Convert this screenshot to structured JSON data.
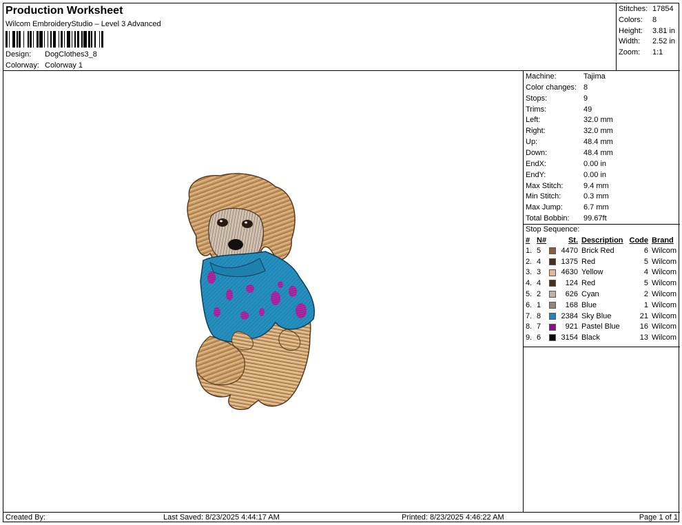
{
  "header": {
    "title": "Production Worksheet",
    "subtitle": "Wilcom EmbroideryStudio – Level 3 Advanced",
    "design_label": "Design:",
    "design_value": "DogClothes3_8",
    "colorway_label": "Colorway:",
    "colorway_value": "Colorway 1"
  },
  "stats": [
    {
      "k": "Stitches:",
      "v": "17854"
    },
    {
      "k": "Colors:",
      "v": "8"
    },
    {
      "k": "Height:",
      "v": "3.81 in"
    },
    {
      "k": "Width:",
      "v": "2.52 in"
    },
    {
      "k": "Zoom:",
      "v": "1:1"
    }
  ],
  "machine_info": [
    {
      "k": "Machine:",
      "v": "Tajima"
    },
    {
      "k": "Color changes:",
      "v": "8"
    },
    {
      "k": "Stops:",
      "v": "9"
    },
    {
      "k": "Trims:",
      "v": "49"
    },
    {
      "k": "Left:",
      "v": "32.0 mm"
    },
    {
      "k": "Right:",
      "v": "32.0 mm"
    },
    {
      "k": "Up:",
      "v": "48.4 mm"
    },
    {
      "k": "Down:",
      "v": "48.4 mm"
    },
    {
      "k": "EndX:",
      "v": "0.00 in"
    },
    {
      "k": "EndY:",
      "v": "0.00 in"
    },
    {
      "k": "Max Stitch:",
      "v": "9.4 mm"
    },
    {
      "k": "Min Stitch:",
      "v": "0.3 mm"
    },
    {
      "k": "Max Jump:",
      "v": "6.7 mm"
    },
    {
      "k": "Total Bobbin:",
      "v": "99.67ft"
    }
  ],
  "stop_sequence": {
    "title": "Stop Sequence:",
    "headers": {
      "idx": "#",
      "n": "N#",
      "st": "St.",
      "desc": "Description",
      "code": "Code",
      "brand": "Brand"
    },
    "rows": [
      {
        "idx": "1.",
        "n": "5",
        "color": "#8c5a3c",
        "st": "4470",
        "desc": "Brick Red",
        "code": "6",
        "brand": "Wilcom"
      },
      {
        "idx": "2.",
        "n": "4",
        "color": "#4a2e1e",
        "st": "1375",
        "desc": "Red",
        "code": "5",
        "brand": "Wilcom"
      },
      {
        "idx": "3.",
        "n": "3",
        "color": "#e2b897",
        "st": "4630",
        "desc": "Yellow",
        "code": "4",
        "brand": "Wilcom"
      },
      {
        "idx": "4.",
        "n": "4",
        "color": "#4a2e1e",
        "st": "124",
        "desc": "Red",
        "code": "5",
        "brand": "Wilcom"
      },
      {
        "idx": "5.",
        "n": "2",
        "color": "#c2b2a6",
        "st": "626",
        "desc": "Cyan",
        "code": "2",
        "brand": "Wilcom"
      },
      {
        "idx": "6.",
        "n": "1",
        "color": "#9a8678",
        "st": "168",
        "desc": "Blue",
        "code": "1",
        "brand": "Wilcom"
      },
      {
        "idx": "7.",
        "n": "8",
        "color": "#1f86c4",
        "st": "2384",
        "desc": "Sky Blue",
        "code": "21",
        "brand": "Wilcom"
      },
      {
        "idx": "8.",
        "n": "7",
        "color": "#8e0f8a",
        "st": "921",
        "desc": "Pastel Blue",
        "code": "16",
        "brand": "Wilcom"
      },
      {
        "idx": "9.",
        "n": "6",
        "color": "#0a0a0a",
        "st": "3154",
        "desc": "Black",
        "code": "13",
        "brand": "Wilcom"
      }
    ]
  },
  "footer": {
    "created_by": "Created By:",
    "last_saved": "Last Saved: 8/23/2025 4:44:17 AM",
    "printed": "Printed: 8/23/2025 4:46:22 AM",
    "page": "Page 1 of 1"
  }
}
